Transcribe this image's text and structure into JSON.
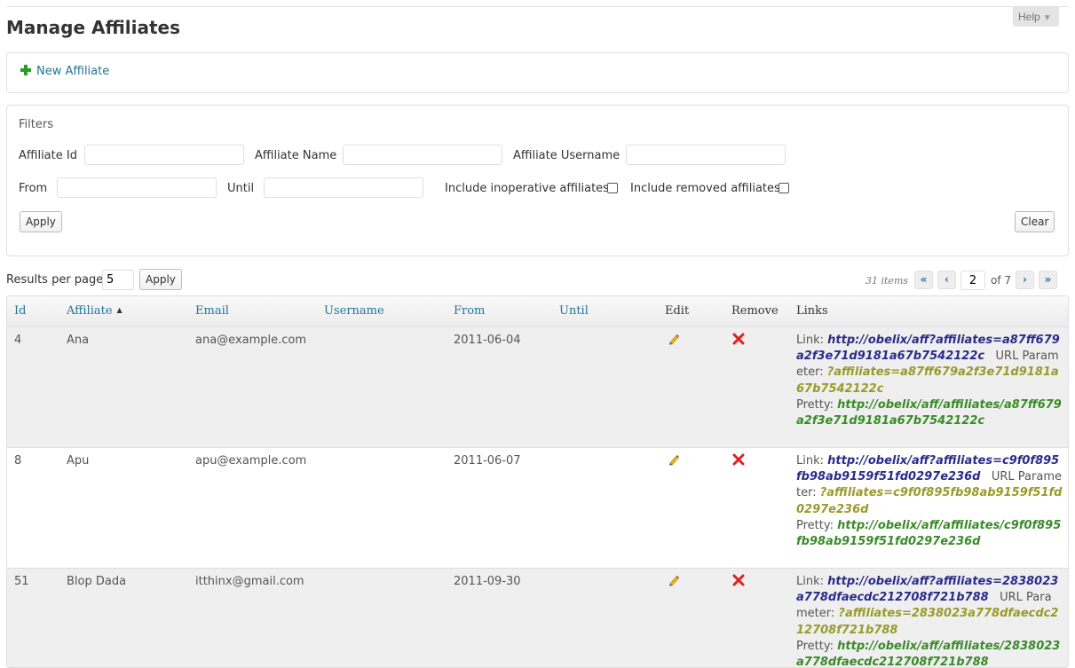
{
  "page": {
    "title": "Manage Affiliates",
    "help_label": "Help"
  },
  "new_affiliate": {
    "label": "New Affiliate"
  },
  "filters": {
    "title": "Filters",
    "affiliate_id_label": "Affiliate Id",
    "affiliate_name_label": "Affiliate Name",
    "affiliate_username_label": "Affiliate Username",
    "from_label": "From",
    "until_label": "Until",
    "include_inoperative_label": "Include inoperative affiliates",
    "include_removed_label": "Include removed affiliates",
    "apply_label": "Apply",
    "clear_label": "Clear"
  },
  "results": {
    "per_page_label": "Results per page",
    "per_page_value": "5",
    "apply_label": "Apply",
    "items_count": "31 items",
    "first_label": "«",
    "prev_label": "‹",
    "current_page": "2",
    "of_label": "of 7",
    "next_label": "›",
    "last_label": "»"
  },
  "table": {
    "columns": {
      "id": "Id",
      "affiliate": "Affiliate",
      "email": "Email",
      "username": "Username",
      "from": "From",
      "until": "Until",
      "edit": "Edit",
      "remove": "Remove",
      "links": "Links"
    },
    "sort_indicator": "▲",
    "link_label": "Link:",
    "url_param_label": "URL Parameter:",
    "pretty_label": "Pretty:",
    "rows": [
      {
        "id": "4",
        "affiliate": "Ana",
        "email": "ana@example.com",
        "username": "",
        "from": "2011-06-04",
        "until": "",
        "link": "http://obelix/aff?affiliates=a87ff679a2f3e71d9181a67b7542122c",
        "url_param": "?affiliates=a87ff679a2f3e71d9181a67b7542122c",
        "pretty": "http://obelix/aff/affiliates/a87ff679a2f3e71d9181a67b7542122c"
      },
      {
        "id": "8",
        "affiliate": "Apu",
        "email": "apu@example.com",
        "username": "",
        "from": "2011-06-07",
        "until": "",
        "link": "http://obelix/aff?affiliates=c9f0f895fb98ab9159f51fd0297e236d",
        "url_param": "?affiliates=c9f0f895fb98ab9159f51fd0297e236d",
        "pretty": "http://obelix/aff/affiliates/c9f0f895fb98ab9159f51fd0297e236d"
      },
      {
        "id": "51",
        "affiliate": "Blop Dada",
        "email": "itthinx@gmail.com",
        "username": "",
        "from": "2011-09-30",
        "until": "",
        "link": "http://obelix/aff?affiliates=2838023a778dfaecdc212708f721b788",
        "url_param": "?affiliates=2838023a778dfaecdc212708f721b788",
        "pretty": "http://obelix/aff/affiliates/2838023a778dfaecdc212708f721b788"
      }
    ]
  }
}
